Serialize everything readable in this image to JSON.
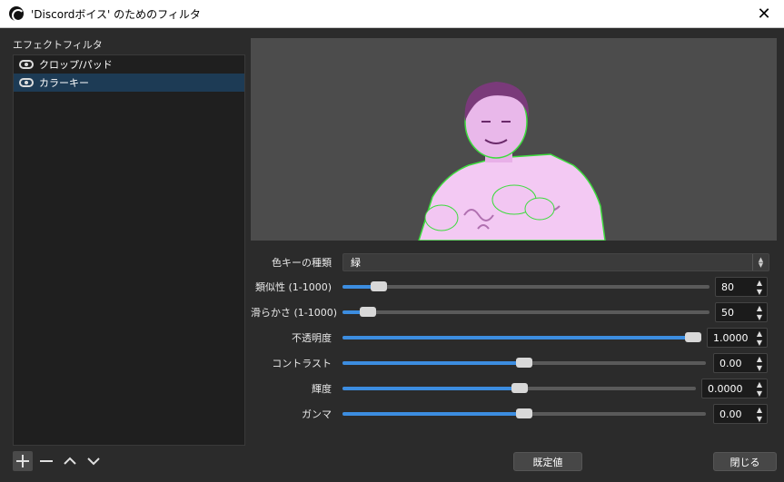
{
  "window": {
    "title": "'Discordボイス' のためのフィルタ",
    "close_symbol": "✕"
  },
  "filters": {
    "label": "エフェクトフィルタ",
    "items": [
      {
        "label": "クロップ/パッド",
        "selected": false
      },
      {
        "label": "カラーキー",
        "selected": true
      }
    ]
  },
  "toolbar": {
    "add_symbol": "+",
    "remove_symbol": "—",
    "up_symbol": "︿",
    "down_symbol": "﹀"
  },
  "properties": {
    "key_color_type": {
      "label": "色キーの種類",
      "value": "緑"
    },
    "similarity": {
      "label": "類似性 (1-1000)",
      "value": "80",
      "fraction": 0.08
    },
    "smoothness": {
      "label": "滑らかさ (1-1000)",
      "value": "50",
      "fraction": 0.05
    },
    "opacity": {
      "label": "不透明度",
      "value": "1.0000",
      "fraction": 1.0
    },
    "contrast": {
      "label": "コントラスト",
      "value": "0.00",
      "fraction": 0.5
    },
    "brightness": {
      "label": "輝度",
      "value": "0.0000",
      "fraction": 0.5
    },
    "gamma": {
      "label": "ガンマ",
      "value": "0.00",
      "fraction": 0.5
    }
  },
  "buttons": {
    "defaults_label": "既定値",
    "close_label": "閉じる"
  },
  "colors": {
    "accent": "#3c8de0",
    "selection": "#1d3b55",
    "keyed_tint": "#f0a8f0",
    "key_edge": "#3ddc3d"
  },
  "icons": {
    "app": "obs-icon",
    "visibility": "eye-icon"
  }
}
